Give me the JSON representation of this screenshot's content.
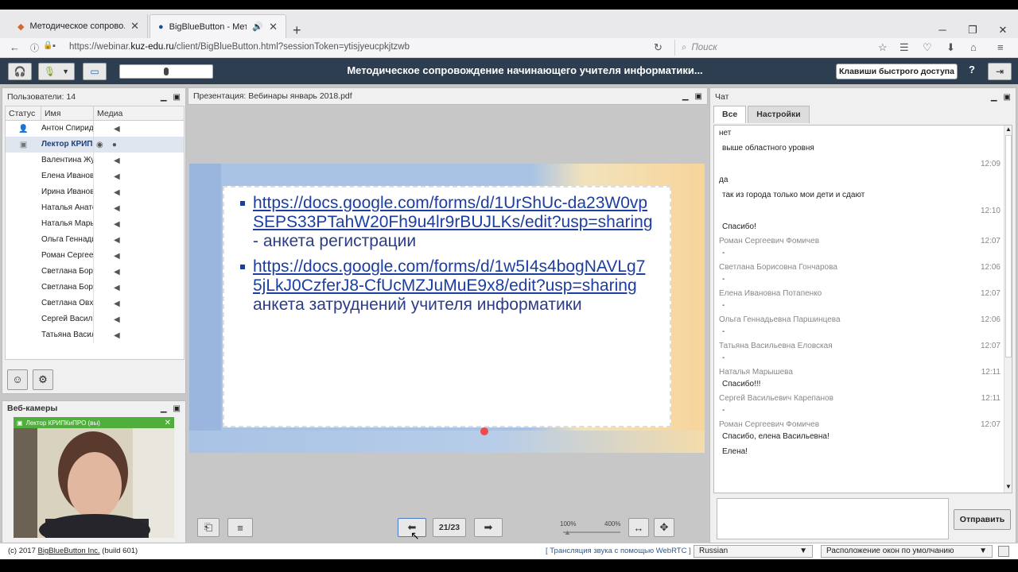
{
  "browser": {
    "tabs": [
      {
        "label": "Методическое сопрово..."
      },
      {
        "label": "BigBlueButton - Мето..."
      }
    ],
    "url_prefix": "https://webinar.",
    "url_host": "kuz-edu.ru",
    "url_path": "/client/BigBlueButton.html?sessionToken=ytisjyeucpkjtzwb",
    "search_placeholder": "Поиск"
  },
  "header": {
    "title": "Методическое сопровождение начинающего учителя информатики...",
    "shortcuts_label": "Клавиши быстрого доступа",
    "help_label": "?"
  },
  "users": {
    "title": "Пользователи: 14",
    "columns": [
      "Статус",
      "Имя",
      "Медиа"
    ],
    "rows": [
      {
        "name": "Антон Спиридо"
      },
      {
        "name": "Лектор КРИПКиПРО"
      },
      {
        "name": "Валентина Жу"
      },
      {
        "name": "Елена Ивановн"
      },
      {
        "name": "Ирина Ивановн"
      },
      {
        "name": "Наталья Анато"
      },
      {
        "name": "Наталья Марыш"
      },
      {
        "name": "Ольга Геннади"
      },
      {
        "name": "Роман Сергеев"
      },
      {
        "name": "Светлана Бори"
      },
      {
        "name": "Светлана Бори"
      },
      {
        "name": "Светлана Овх"
      },
      {
        "name": "Сергей Василь"
      },
      {
        "name": "Татьяна Васил"
      }
    ]
  },
  "webcams": {
    "title": "Веб-камеры",
    "label": "Лектор КРИПКиПРО (вы)"
  },
  "presentation": {
    "title": "Презентация: Вебинары январь 2018.pdf",
    "link1": "https://docs.google.com/forms/d/1UrShUc-da23W0vpSEPS33PTahW20Fh9u4lr9rBUJLKs/edit?usp=sharing",
    "text1": " - анкета регистрации",
    "link2": "https://docs.google.com/forms/d/1w5I4s4bogNAVLg75jLkJ0CzferJ8-CfUcMZJuMuE9x8/edit?usp=sharing",
    "text2": "    анкета затруднений учителя информатики",
    "page": "21/23",
    "zoom_min": "100%",
    "zoom_max": "400%"
  },
  "chat": {
    "title": "Чат",
    "tabs": [
      "Все",
      "Настройки"
    ],
    "messages": [
      {
        "who": "",
        "time": "",
        "text": "нет"
      },
      {
        "who": "",
        "time": "12:09",
        "text": "выше областного уровня"
      },
      {
        "who": "",
        "time": "",
        "text": "да"
      },
      {
        "who": "",
        "time": "12:10",
        "text": "так из города только мои дети и сдают"
      },
      {
        "who": "",
        "time": "",
        "text": "Спасибо!"
      },
      {
        "who": "Роман Сергеевич Фомичев",
        "time": "12:07",
        "text": "-"
      },
      {
        "who": "Светлана Борисовна Гончарова",
        "time": "12:06",
        "text": "-"
      },
      {
        "who": "Елена Ивановна Потапенко",
        "time": "12:07",
        "text": "-"
      },
      {
        "who": "Ольга Геннадьевна Паршинцева",
        "time": "12:06",
        "text": "-"
      },
      {
        "who": "Татьяна Васильевна Еловская",
        "time": "12:07",
        "text": "-"
      },
      {
        "who": "Наталья Марышева",
        "time": "12:11",
        "text": "Спасибо!!!"
      },
      {
        "who": "Сергей Васильевич Карепанов",
        "time": "12:11",
        "text": "-"
      },
      {
        "who": "Роман Сергеевич Фомичев",
        "time": "12:07",
        "text": "Спасибо, елена Васильевна!"
      },
      {
        "who": "",
        "time": "",
        "text": "Елена!"
      }
    ],
    "send_label": "Отправить"
  },
  "footer": {
    "copyright": "(c) 2017 ",
    "bbb_link": "BigBlueButton Inc.",
    "build": " (build 601)",
    "webrtc": "[ Трансляция звука с помощью WebRTC ]",
    "language": "Russian",
    "layout": "Расположение окон по умолчанию"
  }
}
